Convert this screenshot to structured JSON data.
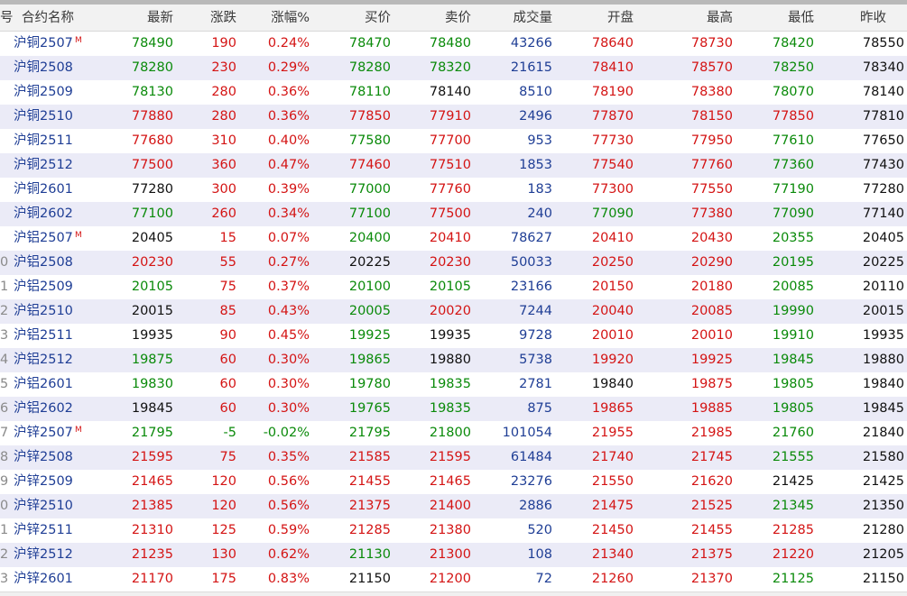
{
  "columns": {
    "idx": "号",
    "name": "合约名称",
    "last": "最新",
    "change": "涨跌",
    "pct": "涨幅%",
    "bid": "买价",
    "ask": "卖价",
    "volume": "成交量",
    "open": "开盘",
    "high": "最高",
    "low": "最低",
    "prev": "昨收"
  },
  "rows": [
    {
      "idx": "",
      "name": "沪铜2507",
      "flag": "M",
      "last": "78490",
      "change": "190",
      "pct": "0.24%",
      "bid": "78470",
      "ask": "78480",
      "volume": "43266",
      "open": "78640",
      "high": "78730",
      "low": "78420",
      "prev": "78550"
    },
    {
      "idx": "",
      "name": "沪铜2508",
      "flag": "",
      "last": "78280",
      "change": "230",
      "pct": "0.29%",
      "bid": "78280",
      "ask": "78320",
      "volume": "21615",
      "open": "78410",
      "high": "78570",
      "low": "78250",
      "prev": "78340"
    },
    {
      "idx": "",
      "name": "沪铜2509",
      "flag": "",
      "last": "78130",
      "change": "280",
      "pct": "0.36%",
      "bid": "78110",
      "ask": "78140",
      "volume": "8510",
      "open": "78190",
      "high": "78380",
      "low": "78070",
      "prev": "78140"
    },
    {
      "idx": "",
      "name": "沪铜2510",
      "flag": "",
      "last": "77880",
      "change": "280",
      "pct": "0.36%",
      "bid": "77850",
      "ask": "77910",
      "volume": "2496",
      "open": "77870",
      "high": "78150",
      "low": "77850",
      "prev": "77810"
    },
    {
      "idx": "",
      "name": "沪铜2511",
      "flag": "",
      "last": "77680",
      "change": "310",
      "pct": "0.40%",
      "bid": "77580",
      "ask": "77700",
      "volume": "953",
      "open": "77730",
      "high": "77950",
      "low": "77610",
      "prev": "77650"
    },
    {
      "idx": "",
      "name": "沪铜2512",
      "flag": "",
      "last": "77500",
      "change": "360",
      "pct": "0.47%",
      "bid": "77460",
      "ask": "77510",
      "volume": "1853",
      "open": "77540",
      "high": "77760",
      "low": "77360",
      "prev": "77430"
    },
    {
      "idx": "",
      "name": "沪铜2601",
      "flag": "",
      "last": "77280",
      "change": "300",
      "pct": "0.39%",
      "bid": "77000",
      "ask": "77760",
      "volume": "183",
      "open": "77300",
      "high": "77550",
      "low": "77190",
      "prev": "77280"
    },
    {
      "idx": "",
      "name": "沪铜2602",
      "flag": "",
      "last": "77100",
      "change": "260",
      "pct": "0.34%",
      "bid": "77100",
      "ask": "77500",
      "volume": "240",
      "open": "77090",
      "high": "77380",
      "low": "77090",
      "prev": "77140"
    },
    {
      "idx": "",
      "name": "沪铝2507",
      "flag": "M",
      "last": "20405",
      "change": "15",
      "pct": "0.07%",
      "bid": "20400",
      "ask": "20410",
      "volume": "78627",
      "open": "20410",
      "high": "20430",
      "low": "20355",
      "prev": "20405"
    },
    {
      "idx": "0",
      "name": "沪铝2508",
      "flag": "",
      "last": "20230",
      "change": "55",
      "pct": "0.27%",
      "bid": "20225",
      "ask": "20230",
      "volume": "50033",
      "open": "20250",
      "high": "20290",
      "low": "20195",
      "prev": "20225"
    },
    {
      "idx": "1",
      "name": "沪铝2509",
      "flag": "",
      "last": "20105",
      "change": "75",
      "pct": "0.37%",
      "bid": "20100",
      "ask": "20105",
      "volume": "23166",
      "open": "20150",
      "high": "20180",
      "low": "20085",
      "prev": "20110"
    },
    {
      "idx": "2",
      "name": "沪铝2510",
      "flag": "",
      "last": "20015",
      "change": "85",
      "pct": "0.43%",
      "bid": "20005",
      "ask": "20020",
      "volume": "7244",
      "open": "20040",
      "high": "20085",
      "low": "19990",
      "prev": "20015"
    },
    {
      "idx": "3",
      "name": "沪铝2511",
      "flag": "",
      "last": "19935",
      "change": "90",
      "pct": "0.45%",
      "bid": "19925",
      "ask": "19935",
      "volume": "9728",
      "open": "20010",
      "high": "20010",
      "low": "19910",
      "prev": "19935"
    },
    {
      "idx": "4",
      "name": "沪铝2512",
      "flag": "",
      "last": "19875",
      "change": "60",
      "pct": "0.30%",
      "bid": "19865",
      "ask": "19880",
      "volume": "5738",
      "open": "19920",
      "high": "19925",
      "low": "19845",
      "prev": "19880"
    },
    {
      "idx": "5",
      "name": "沪铝2601",
      "flag": "",
      "last": "19830",
      "change": "60",
      "pct": "0.30%",
      "bid": "19780",
      "ask": "19835",
      "volume": "2781",
      "open": "19840",
      "high": "19875",
      "low": "19805",
      "prev": "19840"
    },
    {
      "idx": "6",
      "name": "沪铝2602",
      "flag": "",
      "last": "19845",
      "change": "60",
      "pct": "0.30%",
      "bid": "19765",
      "ask": "19835",
      "volume": "875",
      "open": "19865",
      "high": "19885",
      "low": "19805",
      "prev": "19845"
    },
    {
      "idx": "7",
      "name": "沪锌2507",
      "flag": "M",
      "last": "21795",
      "change": "-5",
      "pct": "-0.02%",
      "bid": "21795",
      "ask": "21800",
      "volume": "101054",
      "open": "21955",
      "high": "21985",
      "low": "21760",
      "prev": "21840"
    },
    {
      "idx": "8",
      "name": "沪锌2508",
      "flag": "",
      "last": "21595",
      "change": "75",
      "pct": "0.35%",
      "bid": "21585",
      "ask": "21595",
      "volume": "61484",
      "open": "21740",
      "high": "21745",
      "low": "21555",
      "prev": "21580"
    },
    {
      "idx": "9",
      "name": "沪锌2509",
      "flag": "",
      "last": "21465",
      "change": "120",
      "pct": "0.56%",
      "bid": "21455",
      "ask": "21465",
      "volume": "23276",
      "open": "21550",
      "high": "21620",
      "low": "21425",
      "prev": "21425"
    },
    {
      "idx": "0",
      "name": "沪锌2510",
      "flag": "",
      "last": "21385",
      "change": "120",
      "pct": "0.56%",
      "bid": "21375",
      "ask": "21400",
      "volume": "2886",
      "open": "21475",
      "high": "21525",
      "low": "21345",
      "prev": "21350"
    },
    {
      "idx": "1",
      "name": "沪锌2511",
      "flag": "",
      "last": "21310",
      "change": "125",
      "pct": "0.59%",
      "bid": "21285",
      "ask": "21380",
      "volume": "520",
      "open": "21450",
      "high": "21455",
      "low": "21285",
      "prev": "21280"
    },
    {
      "idx": "2",
      "name": "沪锌2512",
      "flag": "",
      "last": "21235",
      "change": "130",
      "pct": "0.62%",
      "bid": "21130",
      "ask": "21300",
      "volume": "108",
      "open": "21340",
      "high": "21375",
      "low": "21220",
      "prev": "21205"
    },
    {
      "idx": "3",
      "name": "沪锌2601",
      "flag": "",
      "last": "21170",
      "change": "175",
      "pct": "0.83%",
      "bid": "21150",
      "ask": "21200",
      "volume": "72",
      "open": "21260",
      "high": "21370",
      "low": "21125",
      "prev": "21150"
    }
  ],
  "colors": {
    "up": "#d41414",
    "down": "#0a8a0a",
    "name": "#1f3e95",
    "volume": "#1f3e95",
    "neutral": "#111111",
    "alt_row": "#ebebf7",
    "header_bg": "#f2f2f2"
  }
}
